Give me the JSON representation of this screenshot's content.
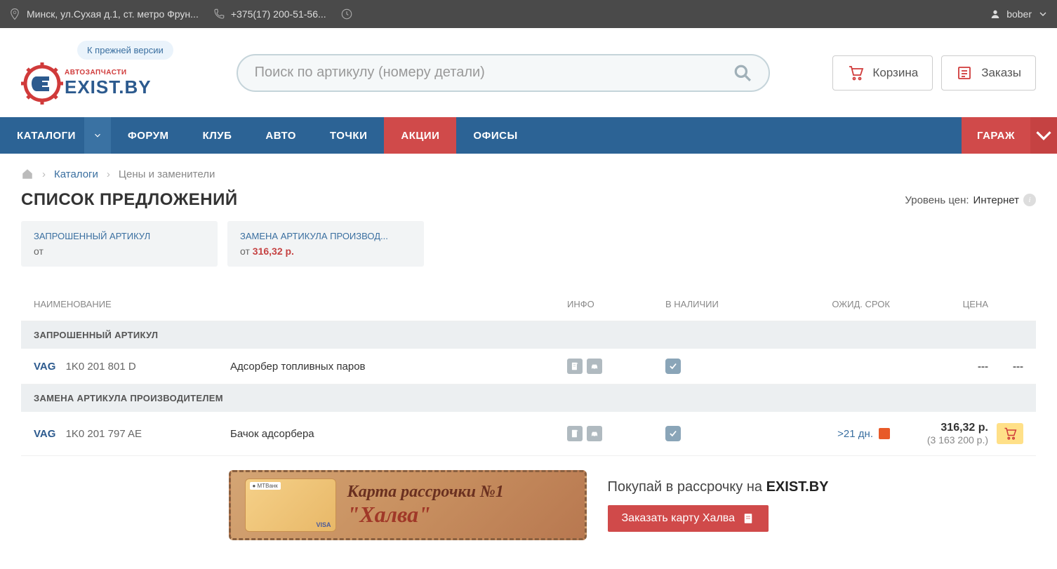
{
  "topbar": {
    "address": "Минск, ул.Сухая д.1, ст. метро Фрун...",
    "phone": "+375(17) 200-51-56...",
    "username": "bober"
  },
  "header": {
    "old_version": "К прежней версии",
    "logo_small": "АВТОЗАПЧАСТИ",
    "logo_big": "EXIST.BY",
    "search_placeholder": "Поиск по артикулу (номеру детали)",
    "cart_label": "Корзина",
    "orders_label": "Заказы"
  },
  "nav": {
    "items": [
      "КАТАЛОГИ",
      "ФОРУМ",
      "КЛУБ",
      "АВТО",
      "ТОЧКИ",
      "АКЦИИ",
      "ОФИСЫ"
    ],
    "garage": "ГАРАЖ"
  },
  "breadcrumb": {
    "catalogs": "Каталоги",
    "current": "Цены и заменители"
  },
  "title": "СПИСОК ПРЕДЛОЖЕНИЙ",
  "price_level": {
    "label": "Уровень цен:",
    "value": "Интернет"
  },
  "summary": [
    {
      "title": "ЗАПРОШЕННЫЙ АРТИКУЛ",
      "sub": "от",
      "price": ""
    },
    {
      "title": "ЗАМЕНА АРТИКУЛА ПРОИЗВОД...",
      "sub": "от ",
      "price": "316,32 р."
    }
  ],
  "table": {
    "headers": {
      "name": "НАИМЕНОВАНИЕ",
      "info": "ИНФО",
      "stock": "В НАЛИЧИИ",
      "eta": "ОЖИД. СРОК",
      "price": "ЦЕНА"
    },
    "sections": [
      {
        "title": "ЗАПРОШЕННЫЙ АРТИКУЛ",
        "rows": [
          {
            "brand": "VAG",
            "article": "1K0 201 801 D",
            "name": "Адсорбер топливных паров",
            "eta": "",
            "price": "---",
            "price_sub": "",
            "dash2": "---",
            "has_cart": false
          }
        ]
      },
      {
        "title": "ЗАМЕНА АРТИКУЛА ПРОИЗВОДИТЕЛЕМ",
        "rows": [
          {
            "brand": "VAG",
            "article": "1K0 201 797 AE",
            "name": "Бачок адсорбера",
            "eta": ">21 дн.",
            "price": "316,32 р.",
            "price_sub": "(3 163 200 р.)",
            "dash2": "",
            "has_cart": true
          }
        ]
      }
    ]
  },
  "promo": {
    "line1": "Карта рассрочки №1",
    "line2": "\"Халва\"",
    "slogan_pre": "Покупай в рассрочку на ",
    "slogan_bold": "EXIST.BY",
    "button": "Заказать карту Халва"
  }
}
